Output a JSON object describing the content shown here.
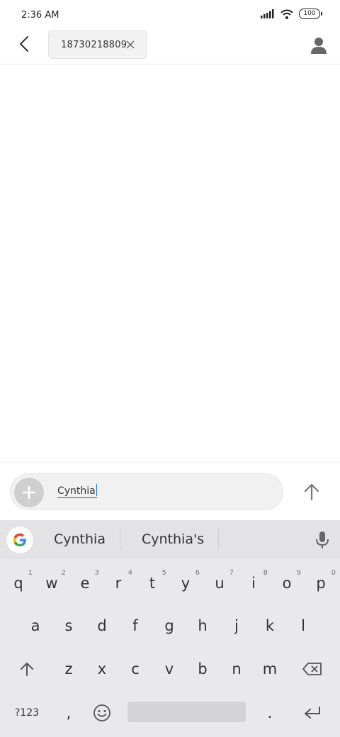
{
  "status": {
    "time": "2:36 AM",
    "battery": "100"
  },
  "header": {
    "recipient": "18730218809"
  },
  "compose": {
    "message_text": "Cynthia"
  },
  "keyboard": {
    "suggestions": [
      "Cynthia",
      "Cynthia's"
    ],
    "row1": [
      "q",
      "w",
      "e",
      "r",
      "t",
      "y",
      "u",
      "i",
      "o",
      "p"
    ],
    "row1_hints": [
      "1",
      "2",
      "3",
      "4",
      "5",
      "6",
      "7",
      "8",
      "9",
      "0"
    ],
    "row2": [
      "a",
      "s",
      "d",
      "f",
      "g",
      "h",
      "j",
      "k",
      "l"
    ],
    "row3": [
      "z",
      "x",
      "c",
      "v",
      "b",
      "n",
      "m"
    ],
    "symbols_key": "?123",
    "comma": ",",
    "period": "."
  }
}
